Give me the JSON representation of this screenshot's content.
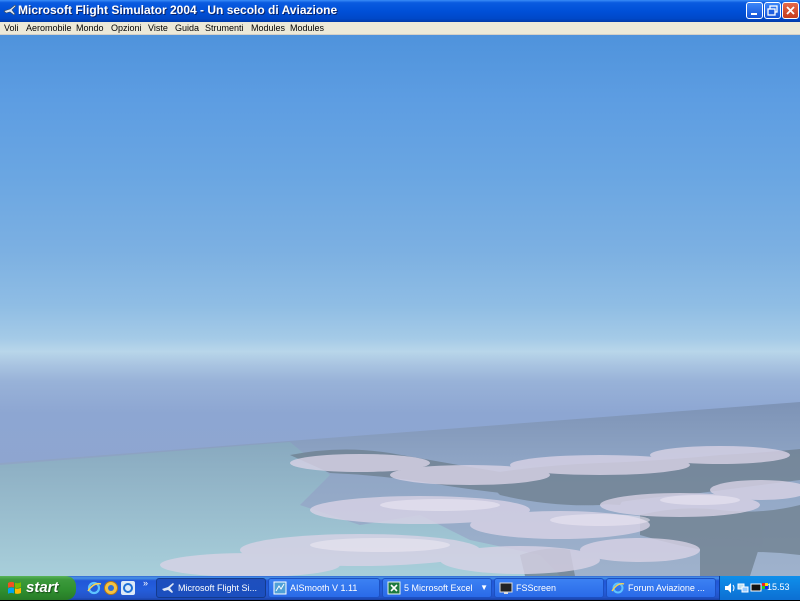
{
  "window": {
    "title": "Microsoft Flight Simulator 2004 - Un secolo di Aviazione",
    "icon": "fs-plane-icon",
    "controls": [
      "minimize-icon",
      "restore-icon",
      "close-icon"
    ]
  },
  "menubar": {
    "items": [
      "Voli",
      "Aeromobile",
      "Mondo",
      "Opzioni",
      "Viste",
      "Guida",
      "Strumenti",
      "Modules",
      "Modules"
    ]
  },
  "viewport": {
    "scene": "sky-horizon-cloud-layer",
    "colors": {
      "sky_top": "#4f93dc",
      "haze": "#b8d6ea",
      "ground": "#8ea5d0",
      "water": "#9cc7d3"
    }
  },
  "taskbar": {
    "start_label": "start",
    "quick_launch": [
      "ie-icon",
      "outlook-icon",
      "ie-alt-icon"
    ],
    "quick_launch_more": "»",
    "tasks": [
      {
        "label": "Microsoft Flight Si...",
        "icon": "fs-plane-icon",
        "active": true
      },
      {
        "label": "AISmooth V 1.11",
        "icon": "app-icon",
        "active": false
      },
      {
        "label": "5 Microsoft Excel",
        "icon": "excel-icon",
        "active": false,
        "has_arrow": true
      },
      {
        "label": "FSScreen",
        "icon": "fsscreen-icon",
        "active": false
      },
      {
        "label": "Forum Aviazione ...",
        "icon": "ie-icon",
        "active": false
      }
    ],
    "tray_icons": [
      "volume-icon",
      "network-icon",
      "monitor-icon",
      "color-icon"
    ],
    "clock": "15.53"
  }
}
